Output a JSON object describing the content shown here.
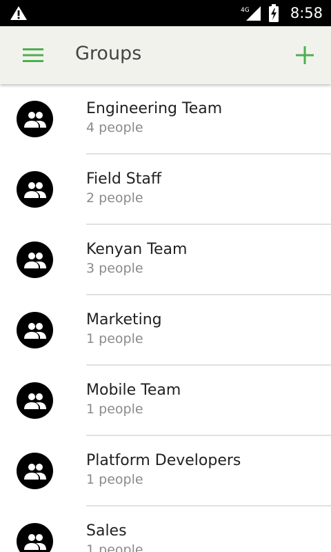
{
  "status_bar": {
    "time": "8:58",
    "network": "4G",
    "icons": [
      "warning-icon",
      "signal-icon",
      "battery-charging-icon"
    ]
  },
  "app_bar": {
    "title": "Groups",
    "menu_icon": "hamburger-menu-icon",
    "add_icon": "plus-icon",
    "accent_color": "#4caf50"
  },
  "groups": [
    {
      "name": "Engineering Team",
      "count": "4 people"
    },
    {
      "name": "Field Staff",
      "count": "2 people"
    },
    {
      "name": "Kenyan Team",
      "count": "3 people"
    },
    {
      "name": "Marketing",
      "count": "1 people"
    },
    {
      "name": "Mobile Team",
      "count": "1 people"
    },
    {
      "name": "Platform Developers",
      "count": "1 people"
    },
    {
      "name": "Sales",
      "count": "1 people"
    }
  ]
}
